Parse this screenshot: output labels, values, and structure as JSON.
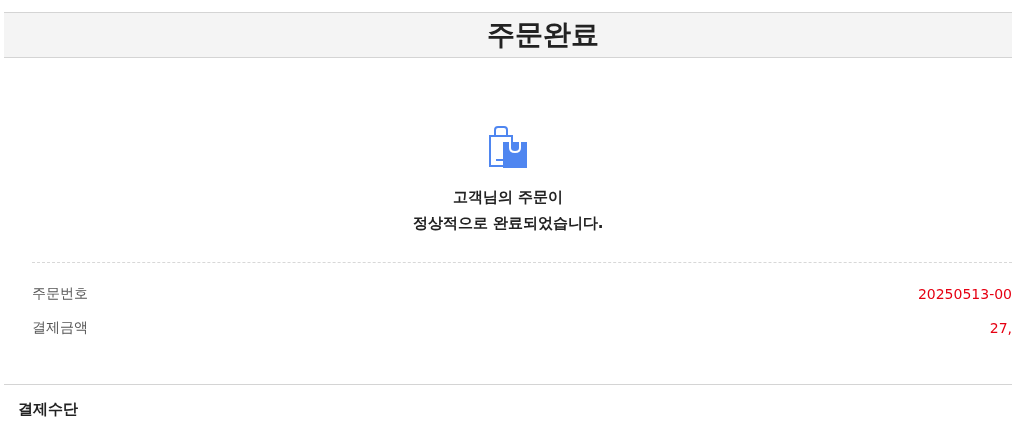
{
  "header": {
    "title": "주문완료"
  },
  "message": {
    "lines": [
      "고객님의 주문이",
      "정상적으로 완료되었습니다."
    ]
  },
  "summary": [
    {
      "label": "주문번호",
      "value": "20250513-00"
    },
    {
      "label": "결제금액",
      "value": "27,"
    }
  ],
  "payment_section": {
    "title": "결제수단"
  }
}
